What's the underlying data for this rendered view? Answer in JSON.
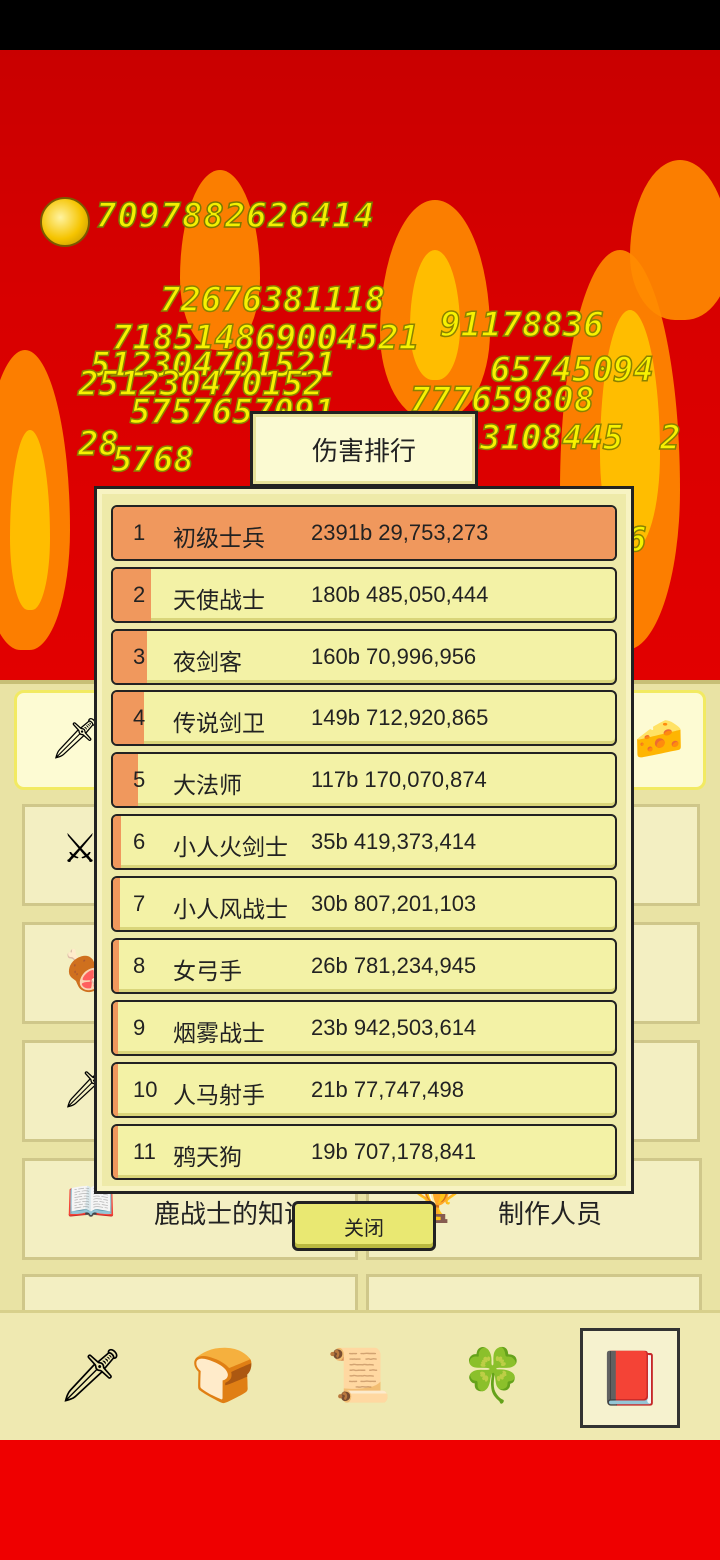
{
  "hud": {
    "gold": "7097882626414"
  },
  "floating_numbers": [
    "72676381118",
    "718514869004521",
    "512304701521",
    "251230470152",
    "5757657091",
    "91178836",
    "65745094",
    "777659808",
    "3108445",
    "2",
    "28",
    "5768",
    "6"
  ],
  "ranking": {
    "title": "伤害排行",
    "close_label": "关闭",
    "rows": [
      {
        "rank": "1",
        "name": "初级士兵",
        "value": "2391b 29,753,273",
        "fraction": 1.0
      },
      {
        "rank": "2",
        "name": "天使战士",
        "value": "180b 485,050,444",
        "fraction": 0.075
      },
      {
        "rank": "3",
        "name": "夜剑客",
        "value": "160b 70,996,956",
        "fraction": 0.067
      },
      {
        "rank": "4",
        "name": "传说剑卫",
        "value": "149b 712,920,865",
        "fraction": 0.062
      },
      {
        "rank": "5",
        "name": "大法师",
        "value": "117b 170,070,874",
        "fraction": 0.049
      },
      {
        "rank": "6",
        "name": "小人火剑士",
        "value": "35b 419,373,414",
        "fraction": 0.015
      },
      {
        "rank": "7",
        "name": "小人风战士",
        "value": "30b 807,201,103",
        "fraction": 0.013
      },
      {
        "rank": "8",
        "name": "女弓手",
        "value": "26b 781,234,945",
        "fraction": 0.011
      },
      {
        "rank": "9",
        "name": "烟雾战士",
        "value": "23b 942,503,614",
        "fraction": 0.01
      },
      {
        "rank": "10",
        "name": "人马射手",
        "value": "21b 77,747,498",
        "fraction": 0.009
      },
      {
        "rank": "11",
        "name": "鸦天狗",
        "value": "19b 707,178,841",
        "fraction": 0.008
      }
    ]
  },
  "background_menu": {
    "knowledge_label": "鹿战士的知识",
    "credits_label": "制作人员"
  },
  "navbar": {
    "items": [
      "sword-icon",
      "bread-icon",
      "scroll-icon",
      "clover-icon",
      "book-icon"
    ],
    "selected": "book-icon"
  },
  "colors": {
    "bar": "#f0985d",
    "row": "#f3f2a6",
    "gold": "#f7f200"
  }
}
